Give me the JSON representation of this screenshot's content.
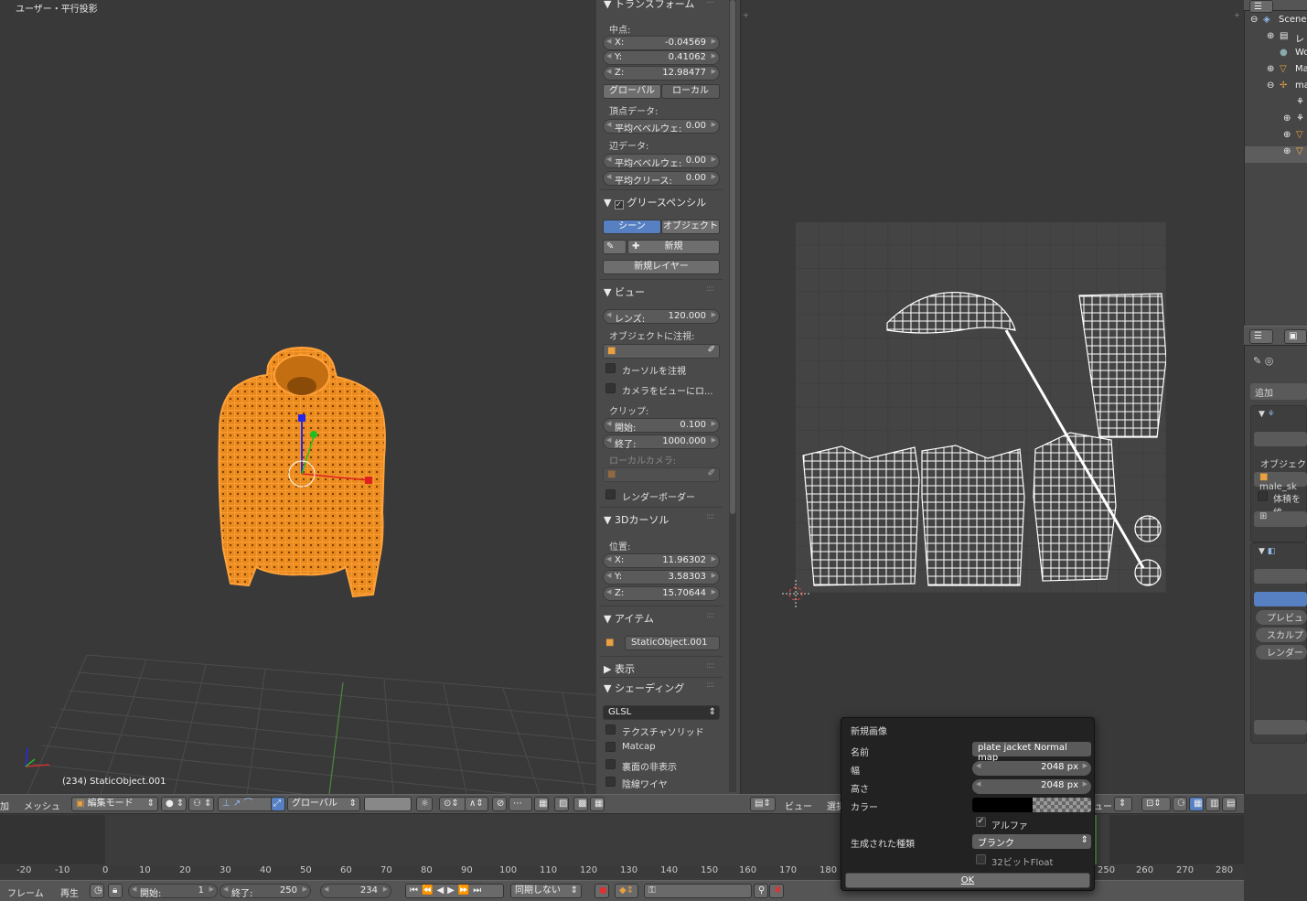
{
  "viewport": {
    "title": "ユーザー・平行投影",
    "object_label": "(234) StaticObject.001"
  },
  "npanel": {
    "transform": {
      "header": "トランスフォーム",
      "median_label": "中点:",
      "x_label": "X:",
      "x": "-0.04569",
      "y_label": "Y:",
      "y": "0.41062",
      "z_label": "Z:",
      "z": "12.98477",
      "global": "グローバル",
      "local": "ローカル",
      "vertex_data": "頂点データ:",
      "vertex_bevel_label": "平均ベベルウェ:",
      "vertex_bevel": "0.00",
      "edge_data": "辺データ:",
      "edge_bevel_label": "平均ベベルウェ:",
      "edge_bevel": "0.00",
      "crease_label": "平均クリース:",
      "crease": "0.00"
    },
    "grease": {
      "header": "グリースペンシル",
      "scene": "シーン",
      "object": "オブジェクト",
      "new": "新規",
      "new_layer": "新規レイヤー"
    },
    "view": {
      "header": "ビュー",
      "lens_label": "レンズ:",
      "lens": "120.000",
      "lock_object": "オブジェクトに注視:",
      "lock_cursor": "カーソルを注視",
      "lock_camera": "カメラをビューにロ...",
      "clip": "クリップ:",
      "start_label": "開始:",
      "start": "0.100",
      "end_label": "終了:",
      "end": "1000.000",
      "local_camera": "ローカルカメラ:",
      "render_border": "レンダーボーダー"
    },
    "cursor": {
      "header": "3Dカーソル",
      "location": "位置:",
      "x_label": "X:",
      "x": "11.96302",
      "y_label": "Y:",
      "y": "3.58303",
      "z_label": "Z:",
      "z": "15.70644"
    },
    "item": {
      "header": "アイテム",
      "name": "StaticObject.001"
    },
    "display": {
      "header": "表示"
    },
    "shading": {
      "header": "シェーディング",
      "mode": "GLSL",
      "textured_solid": "テクスチャソリッド",
      "matcap": "Matcap",
      "backface": "裏面の非表示",
      "hidden_wire": "陰線ワイヤ"
    }
  },
  "view3d_header": {
    "add": "加",
    "mesh": "メッシュ",
    "mode": "編集モード",
    "orientation": "グローバル"
  },
  "uv_header": {
    "view": "ビュー",
    "select": "選択",
    "uv_partial": "U",
    "image_partial": "ュー"
  },
  "outliner": {
    "items": [
      "Scene",
      "レ",
      "Wo",
      "Ma",
      "ma"
    ]
  },
  "props": {
    "add": "追加",
    "object_label": "オブジェク",
    "object_value": "male_sk",
    "volume": "体積を維",
    "preview": "プレビュ",
    "sculpt": "スカルプ",
    "render": "レンダー"
  },
  "timeline": {
    "ticks": [
      "-20",
      "-10",
      "0",
      "10",
      "20",
      "30",
      "40",
      "50",
      "60",
      "70",
      "80",
      "90",
      "100",
      "110",
      "120",
      "130",
      "140",
      "150",
      "160",
      "170",
      "180",
      "250",
      "260",
      "270",
      "280"
    ],
    "frame": "フレーム",
    "playback": "再生",
    "start_label": "開始:",
    "start": "1",
    "end_label": "終了:",
    "end": "250",
    "current": "234",
    "sync": "同期しない"
  },
  "dialog": {
    "title": "新規画像",
    "name_label": "名前",
    "name": "plate jacket Normal map",
    "width_label": "幅",
    "width": "2048 px",
    "height_label": "高さ",
    "height": "2048 px",
    "color_label": "カラー",
    "alpha": "アルファ",
    "type_label": "生成された種類",
    "type": "ブランク",
    "float": "32ビットFloat",
    "ok": "OK"
  },
  "colors": {
    "selection": "#ff8c1a",
    "accent": "#5680c2",
    "uv_wire": "#ffffff"
  }
}
